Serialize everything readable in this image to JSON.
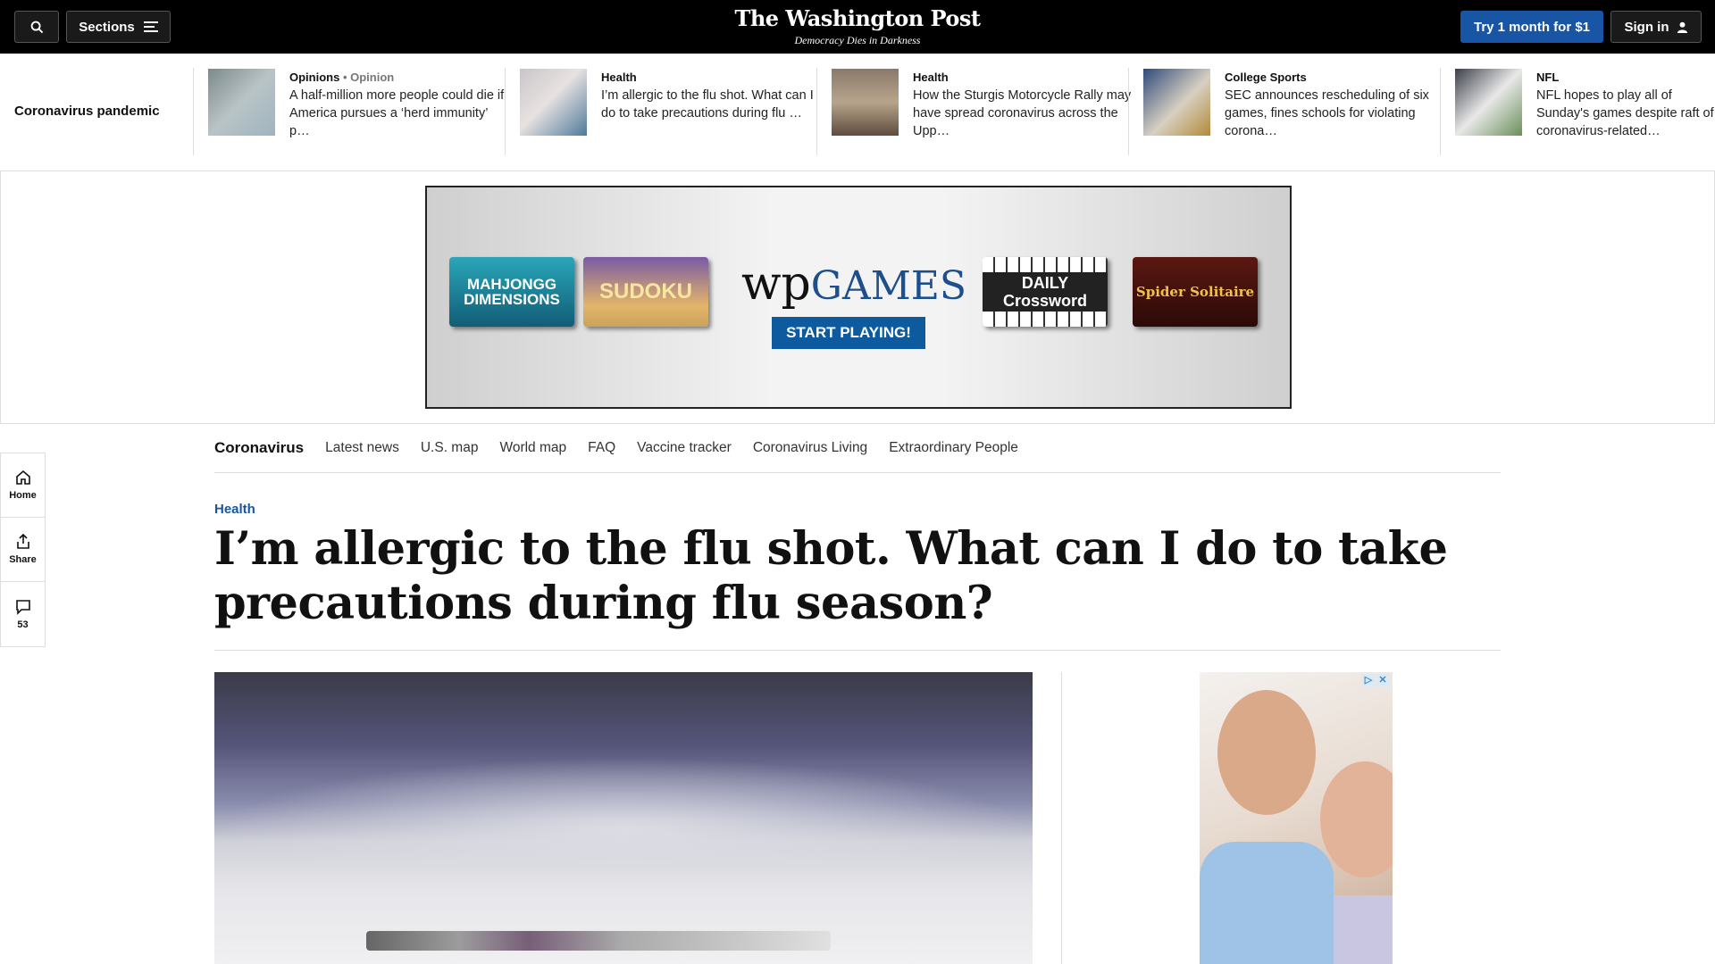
{
  "topbar": {
    "sections_label": "Sections",
    "logo": "The Washington Post",
    "tagline": "Democracy Dies in Darkness",
    "try_label": "Try 1 month for $1",
    "signin_label": "Sign in",
    "accent_color": "#1955a5"
  },
  "strip": {
    "title": "Coronavirus pandemic",
    "cards": [
      {
        "kicker": "Opinions",
        "sub": "• Opinion",
        "headline": "A half-million more people could die if America pursues a ‘herd immunity’ p…"
      },
      {
        "kicker": "Health",
        "sub": "",
        "headline": "I’m allergic to the flu shot. What can I do to take precautions during flu …"
      },
      {
        "kicker": "Health",
        "sub": "",
        "headline": "How the Sturgis Motorcycle Rally may have spread coronavirus across the Upp…"
      },
      {
        "kicker": "College Sports",
        "sub": "",
        "headline": "SEC announces rescheduling of six games, fines schools for violating corona…"
      },
      {
        "kicker": "NFL",
        "sub": "",
        "headline": "NFL hopes to play all of Sunday's games despite raft of coronavirus-related…"
      }
    ]
  },
  "ad_banner": {
    "tiles": [
      "MAHJONGG DIMENSIONS",
      "SUDOKU",
      "DAILY Crossword",
      "Spider Solitaire"
    ],
    "brand_wp": "wp",
    "brand_games": "GAMES",
    "cta": "START PLAYING!"
  },
  "rail": {
    "home_label": "Home",
    "share_label": "Share",
    "comments_count": "53"
  },
  "section_nav": {
    "primary": "Coronavirus",
    "links": [
      "Latest news",
      "U.S. map",
      "World map",
      "FAQ",
      "Vaccine tracker",
      "Coronavirus Living",
      "Extraordinary People"
    ]
  },
  "article": {
    "kicker": "Health",
    "headline": "I’m allergic to the flu shot. What can I do to take precautions during flu season?"
  },
  "side_ad": {
    "choices": [
      "▷",
      "✕"
    ]
  }
}
